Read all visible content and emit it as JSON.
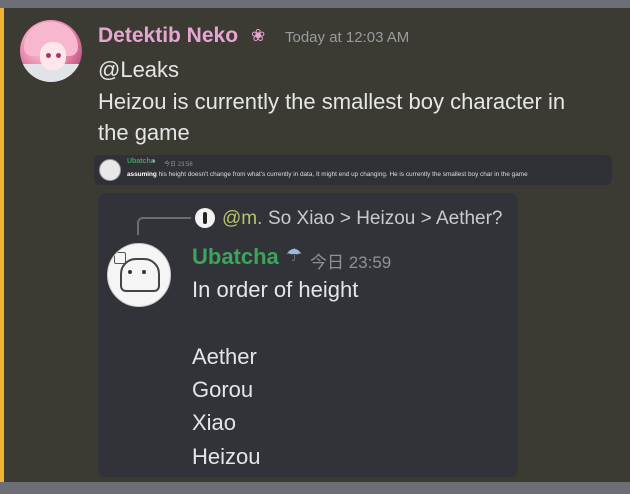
{
  "main_message": {
    "username": "Detektib Neko",
    "badge_glyph": "❀",
    "timestamp": "Today at 12:03 AM",
    "mention": "@Leaks",
    "body_line1": "Heizou is currently the smallest boy character in",
    "body_line2": "the game",
    "accent_color": "#f0b232",
    "username_color": "#e7a6d2"
  },
  "strip_embed": {
    "username": "Ubatcha",
    "icon": "bird-icon",
    "time": "今日 23:56",
    "text_bold": "assuming",
    "text_rest": " his height doesn't change from what's currently in data, It might end up changing. He is currently the smallest boy char in the game"
  },
  "card_embed": {
    "reply": {
      "name": "@m.",
      "text": "So Xiao > Heizou > Aether?"
    },
    "username": "Ubatcha",
    "icon_glyph": "☂",
    "time": "今日 23:59",
    "lines": [
      "In order of height",
      "Aether",
      "Gorou",
      "Xiao",
      "Heizou"
    ],
    "username_color": "#3ba55c"
  }
}
